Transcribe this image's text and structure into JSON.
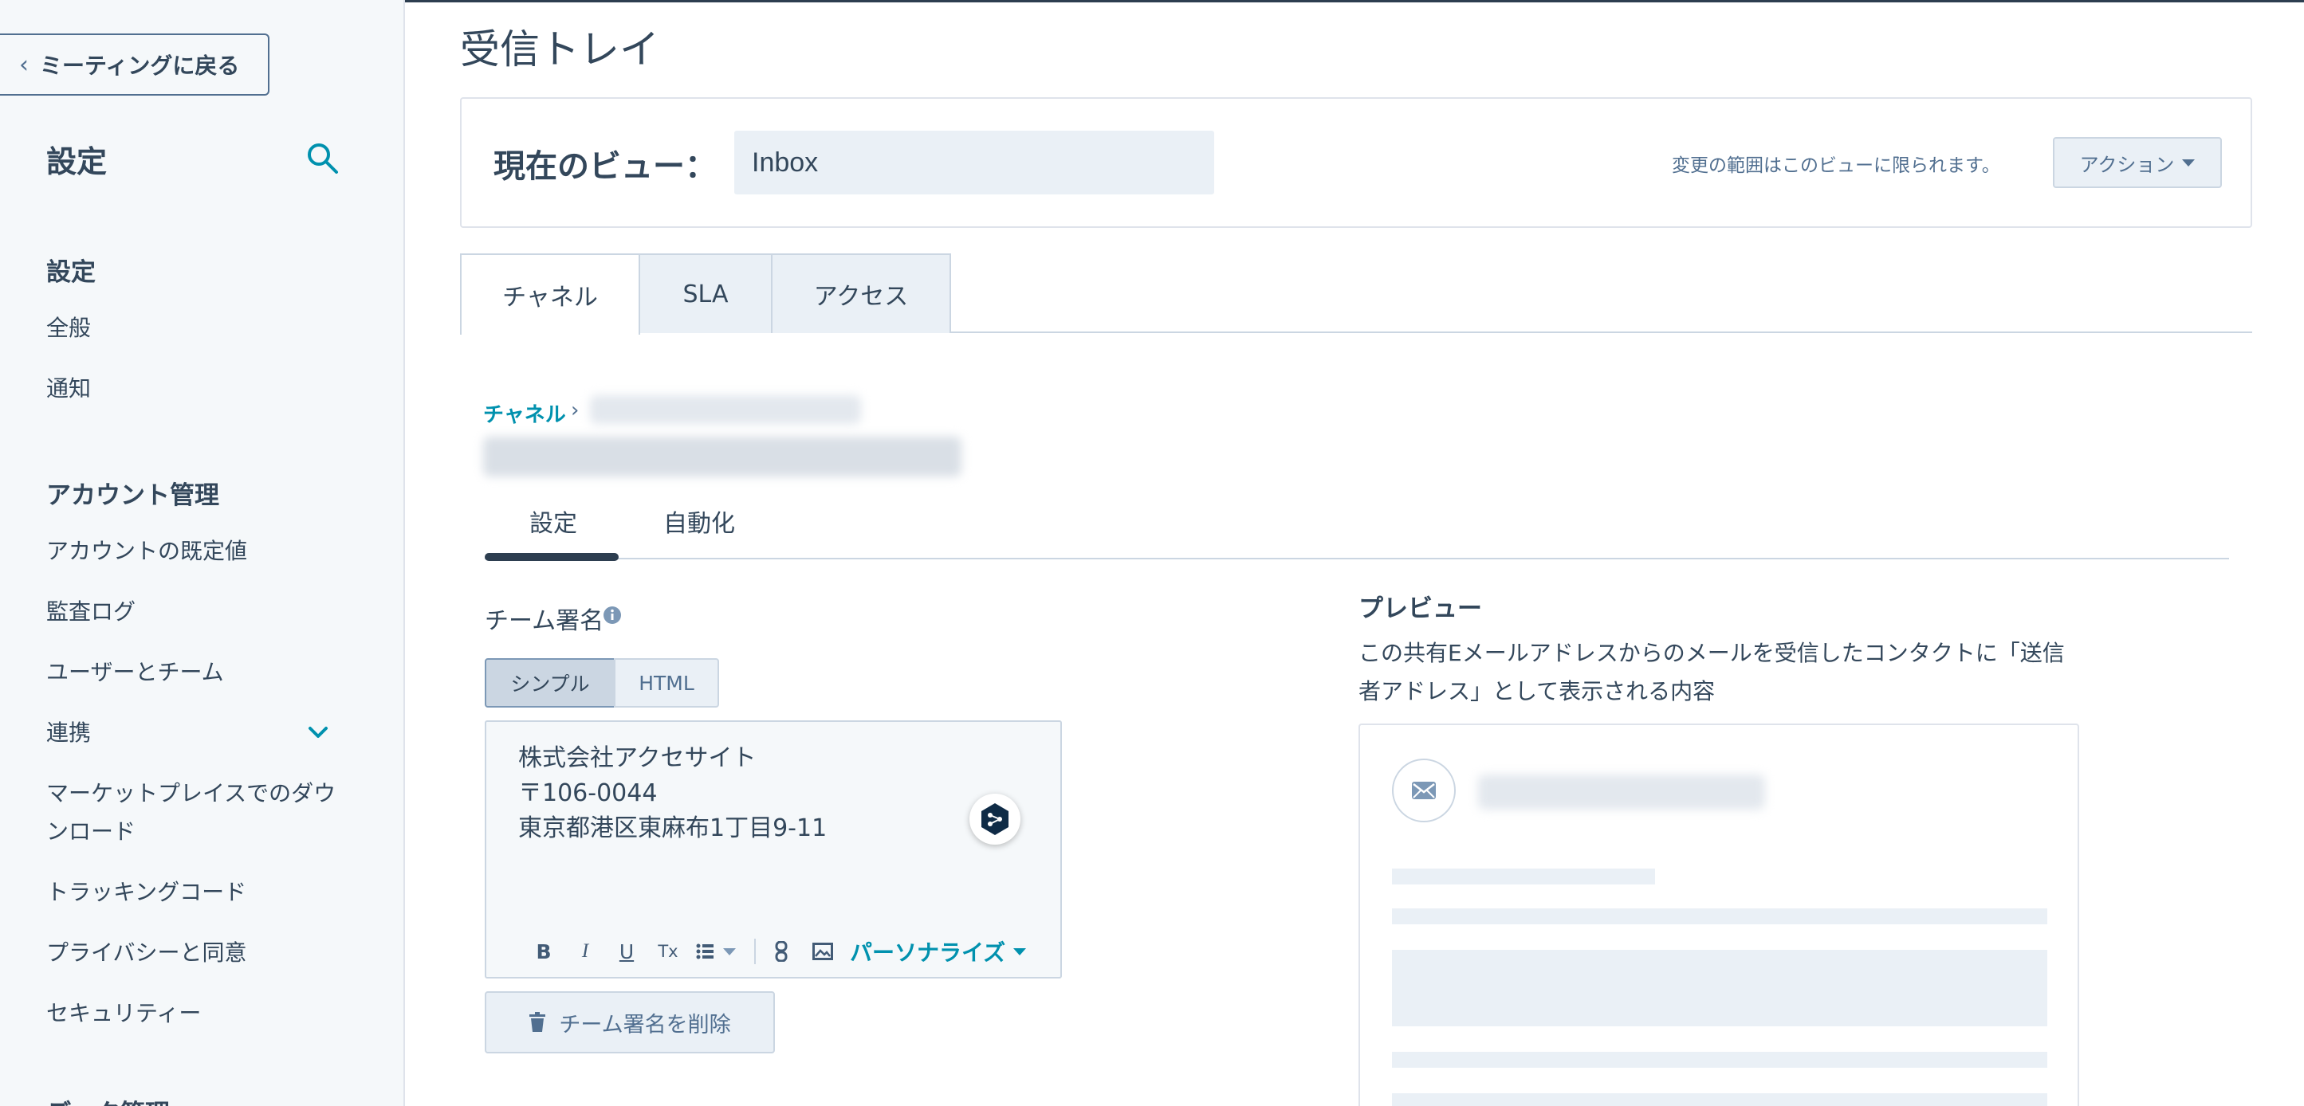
{
  "sidebar": {
    "back_label": "ミーティングに戻る",
    "title": "設定",
    "sections": [
      {
        "label": "設定",
        "items": [
          "全般",
          "通知"
        ]
      },
      {
        "label": "アカウント管理",
        "items": [
          "アカウントの既定値",
          "監査ログ",
          "ユーザーとチーム",
          "連携",
          "マーケットプレイスでのダウンロード",
          "トラッキングコード",
          "プライバシーと同意",
          "セキュリティー"
        ]
      },
      {
        "label": "データ管理"
      }
    ]
  },
  "main": {
    "page_title": "受信トレイ",
    "current_view_label": "現在のビュー：",
    "current_view_value": "Inbox",
    "view_note": "変更の範囲はこのビューに限られます。",
    "actions_label": "アクション",
    "tabs": [
      {
        "label": "チャネル",
        "active": true
      },
      {
        "label": "SLA",
        "active": false
      },
      {
        "label": "アクセス",
        "active": false
      }
    ],
    "breadcrumb": {
      "root": "チャネル",
      "separator": "›"
    },
    "subtabs": [
      {
        "label": "設定",
        "active": true
      },
      {
        "label": "自動化",
        "active": false
      }
    ]
  },
  "signature": {
    "label": "チーム署名",
    "mode_simple": "シンプル",
    "mode_html": "HTML",
    "lines": [
      "株式会社アクセサイト",
      "〒106-0044",
      "東京都港区東麻布1丁目9-11"
    ],
    "toolbar": {
      "bold": "B",
      "italic": "I",
      "underline": "U",
      "clear": "Tx",
      "personalize": "パーソナライズ"
    },
    "delete_label": "チーム署名を削除"
  },
  "preview": {
    "title": "プレビュー",
    "description": "この共有Eメールアドレスからのメールを受信したコンタクトに「送信者アドレス」として表示される内容"
  },
  "colors": {
    "accent": "#0091ae",
    "text": "#33475b",
    "sidebar_bg": "#f5f8fa",
    "border": "#cbd6e2"
  },
  "icons": [
    "search-icon",
    "chevron-left-icon",
    "chevron-down-icon",
    "info-icon",
    "trash-icon",
    "mail-icon",
    "link-icon",
    "image-icon",
    "list-icon"
  ]
}
